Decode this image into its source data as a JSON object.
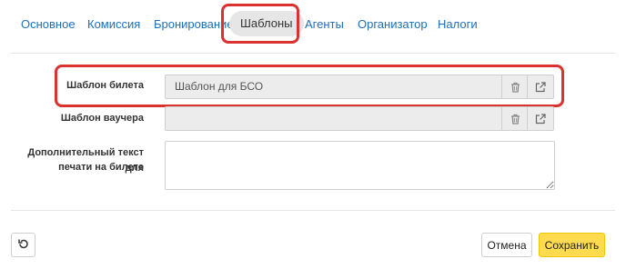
{
  "tabs": [
    {
      "label": "Основное"
    },
    {
      "label": "Комиссия"
    },
    {
      "label": "Бронирование"
    },
    {
      "label": "Шаблоны"
    },
    {
      "label": "Агенты"
    },
    {
      "label": "Организатор"
    },
    {
      "label": "Налоги"
    }
  ],
  "active_tab": "Шаблоны",
  "form": {
    "ticket_template": {
      "label": "Шаблон билета",
      "value": "Шаблон для БСО"
    },
    "voucher_template": {
      "label": "Шаблон ваучера",
      "value": ""
    },
    "extra_text": {
      "label_line1": "Дополнительный текст для",
      "label_line2": "печати на билете",
      "value": ""
    }
  },
  "icons": {
    "delete": "trash-icon",
    "open": "external-link-icon",
    "reset": "undo-icon"
  },
  "footer": {
    "cancel_label": "Отмена",
    "save_label": "Сохранить"
  },
  "colors": {
    "accent_link": "#1f6fb8",
    "highlight": "#d9322f",
    "save_button": "#ffdb4d"
  }
}
